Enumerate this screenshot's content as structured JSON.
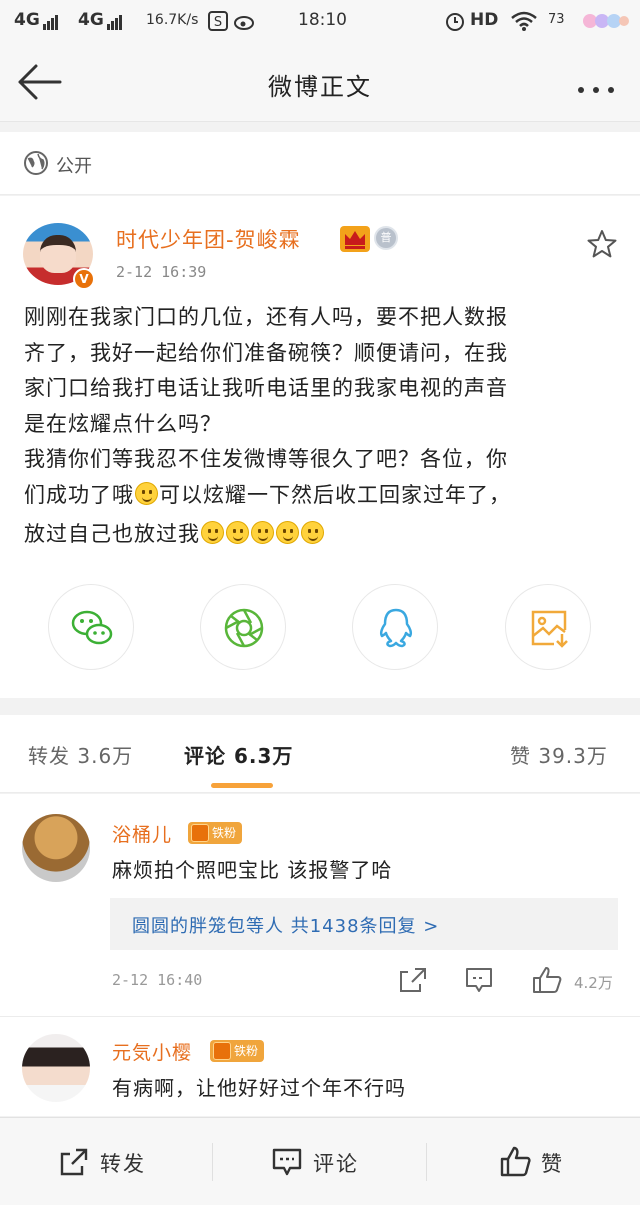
{
  "status_bar": {
    "network1": "4G",
    "network2": "4G",
    "speed": "16.7K/s",
    "time": "18:10",
    "hd": "HD",
    "battery": "73"
  },
  "nav": {
    "title": "微博正文"
  },
  "visibility": {
    "label": "公开"
  },
  "post": {
    "author": "时代少年团-贺峻霖",
    "time": "2-12 16:39",
    "text_line1": "刚刚在我家门口的几位，还有人吗，要不把人数报",
    "text_line2": "齐了，我好一起给你们准备碗筷？顺便请问，在我",
    "text_line3": "家门口给我打电话让我听电话里的我家电视的声音",
    "text_line4": "是在炫耀点什么吗？",
    "text_line5": "我猜你们等我忍不住发微博等很久了吧？各位，你",
    "text_line6a": "们成功了哦",
    "text_line6b": "可以炫耀一下然后收工回家过年了，",
    "text_line7": "放过自己也放过我",
    "avatar_badge": "V",
    "medal_text": "普"
  },
  "share_buttons": [
    {
      "name": "wechat",
      "color": "#3cb035"
    },
    {
      "name": "moments",
      "color": "#59b63a"
    },
    {
      "name": "qq",
      "color": "#3aa8e0"
    },
    {
      "name": "save-image",
      "color": "#f1a93a"
    }
  ],
  "tabs": {
    "repost": "转发 3.6万",
    "comment": "评论 6.3万",
    "like": "赞 39.3万"
  },
  "comments": [
    {
      "user": "浴桶儿",
      "badge": "铁粉",
      "text": "麻烦拍个照吧宝比 该报警了哈",
      "replies": "圆圆的胖笼包等人 共1438条回复 >",
      "time": "2-12 16:40",
      "likes": "4.2万"
    },
    {
      "user": "元気小樱",
      "badge": "铁粉",
      "text": "有病啊，让他好好过个年不行吗"
    }
  ],
  "toolbar": {
    "repost": "转发",
    "comment": "评论",
    "like": "赞"
  },
  "colors": {
    "accent_orange": "#e76f1f",
    "link_blue": "#2f6cb3",
    "tab_underline": "#f7a23a"
  }
}
